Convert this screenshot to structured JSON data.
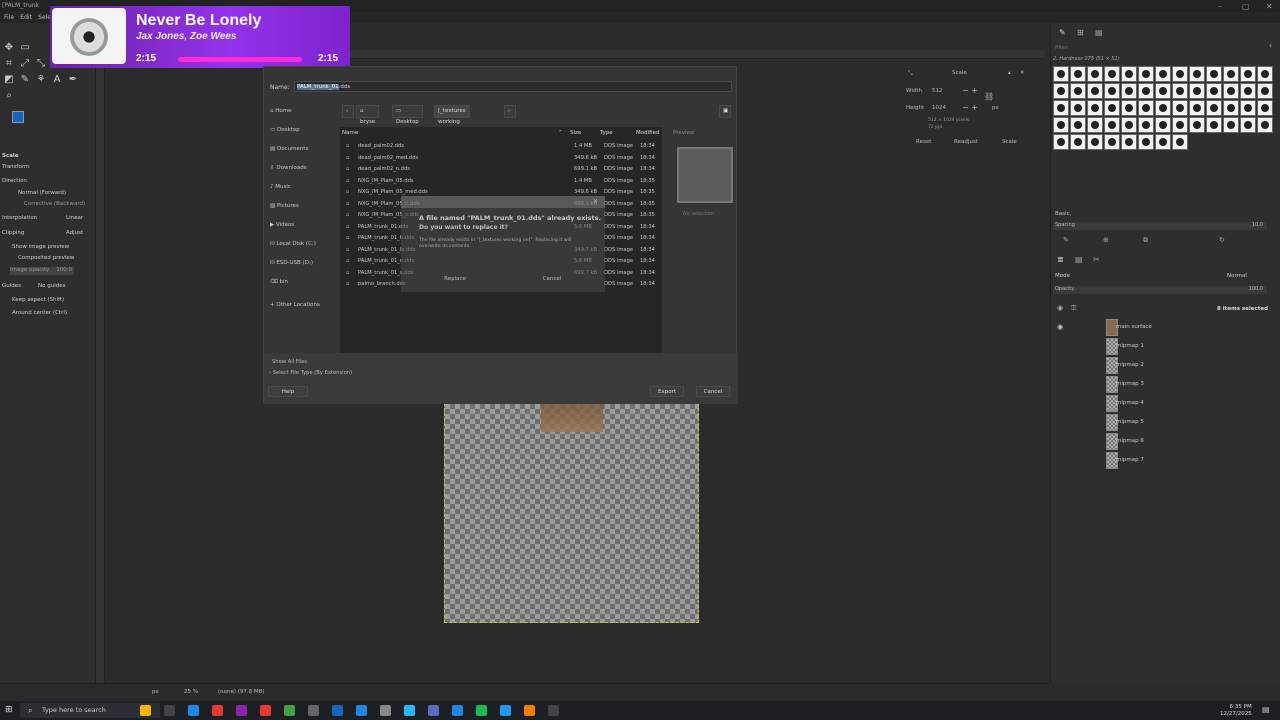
{
  "window": {
    "title": "[PALM_trunk"
  },
  "menu": [
    "File",
    "Edit",
    "Select"
  ],
  "now_playing": {
    "title": "Never Be Lonely",
    "artist": "Jax Jones, Zoe Wees",
    "elapsed": "2:15",
    "total": "2:15",
    "progress": 1.0,
    "bar_color": "#ff2bd6"
  },
  "tool_options": {
    "scale": "Scale",
    "transform": "Transform",
    "direction": "Direction",
    "normal_forward": "Normal (Forward)",
    "corrective_backward": "Corrective (Backward)",
    "interpolation": "Interpolation",
    "interpolation_value": "Linear",
    "clipping": "Clipping",
    "clipping_value": "Adjust",
    "show_preview": "Show image preview",
    "composited_preview": "Composited preview",
    "image_opacity": "Image opacity",
    "image_opacity_value": "100.0",
    "guides": "Guides",
    "guides_value": "No guides",
    "keep_aspect": "Keep aspect (Shift)",
    "around_center": "Around center (Ctrl)"
  },
  "dialog": {
    "name_label": "Name:",
    "filename_selected": "PALM_trunk_01",
    "filename_ext": ".dds",
    "places": [
      "Home",
      "Desktop",
      "Documents",
      "Downloads",
      "Music",
      "Pictures",
      "Videos",
      "Local Disk (C:)",
      "ESD-USB (D:)",
      "bin",
      "Other Locations"
    ],
    "crumbs": [
      "bryse",
      "Desktop",
      "[_textures working on]"
    ],
    "columns": {
      "name": "Name",
      "size": "Size",
      "type": "Type",
      "modified": "Modified",
      "preview": "Preview"
    },
    "files": [
      {
        "name": "dead_palm02.dds",
        "size": "1.4 MB",
        "type": "DDS image",
        "mod": "18:34"
      },
      {
        "name": "dead_palm02_med.dds",
        "size": "349.6 kB",
        "type": "DDS image",
        "mod": "18:34"
      },
      {
        "name": "dead_palm02_n.dds",
        "size": "699.1 kB",
        "type": "DDS image",
        "mod": "18:34"
      },
      {
        "name": "NXG_IM_Plam_05.dds",
        "size": "1.4 MB",
        "type": "DDS image",
        "mod": "18:35"
      },
      {
        "name": "NXG_IM_Plam_05_med.dds",
        "size": "349.6 kB",
        "type": "DDS image",
        "mod": "18:35"
      },
      {
        "name": "NXG_IM_Plam_05_n.dds",
        "size": "699.1 kB",
        "type": "DDS image",
        "mod": "18:35"
      },
      {
        "name": "NXG_IM_Plam_05_s.dds",
        "size": "",
        "type": "DDS image",
        "mod": "18:35"
      },
      {
        "name": "PALM_trunk_01.dds",
        "size": "5.6 MB",
        "type": "DDS image",
        "mod": "18:34"
      },
      {
        "name": "PALM_trunk_01_h.dds",
        "size": "",
        "type": "DDS image",
        "mod": "18:34"
      },
      {
        "name": "PALM_trunk_01_le.dds",
        "size": "349.7 kB",
        "type": "DDS image",
        "mod": "18:34"
      },
      {
        "name": "PALM_trunk_01_n.dds",
        "size": "5.6 MB",
        "type": "DDS image",
        "mod": "18:34"
      },
      {
        "name": "PALM_trunk_01_s.dds",
        "size": "699.7 kB",
        "type": "DDS image",
        "mod": "18:34"
      },
      {
        "name": "palmo_branch.dds",
        "size": "",
        "type": "DDS image",
        "mod": "18:34"
      }
    ],
    "no_selection": "No selection",
    "show_all_files": "Show All Files",
    "select_file_type": "Select File Type (By Extension)",
    "help": "Help",
    "export": "Export",
    "cancel": "Cancel"
  },
  "confirm": {
    "title": "A file named \"PALM_trunk_01.dds\" already exists.",
    "question": "Do you want to replace it?",
    "message_1": "The file already exists in \"[_textures working on]\". Replacing it will",
    "message_2": "overwrite its contents.",
    "replace": "Replace",
    "cancel": "Cancel"
  },
  "scale_panel": {
    "title": "Scale",
    "width_label": "Width",
    "width_value": "512",
    "height_label": "Height",
    "height_value": "1024",
    "unit": "px",
    "dims": "512 × 1024 pixels",
    "res": "72 ppi",
    "reset": "Reset",
    "readjust": "Readjust",
    "scale": "Scale"
  },
  "brushes": {
    "header": "2. Hardness 075 (51 × 51)",
    "filter": "filter",
    "preset": "Basic,",
    "spacing_label": "Spacing",
    "spacing_value": "10.0"
  },
  "layers": {
    "mode_label": "Mode",
    "mode_value": "Normal",
    "opacity_label": "Opacity",
    "opacity_value": "100.0",
    "selected": "8 items selected",
    "items": [
      "main surface",
      "mipmap 1",
      "mipmap 2",
      "mipmap 3",
      "mipmap 4",
      "mipmap 5",
      "mipmap 6",
      "mipmap 7"
    ]
  },
  "status": {
    "unit": "px",
    "zoom": "25 %",
    "info": "(none) (97.8 MB)"
  },
  "taskbar": {
    "search": "Type here to search",
    "time": "6:35 PM",
    "date": "12/27/2025"
  }
}
